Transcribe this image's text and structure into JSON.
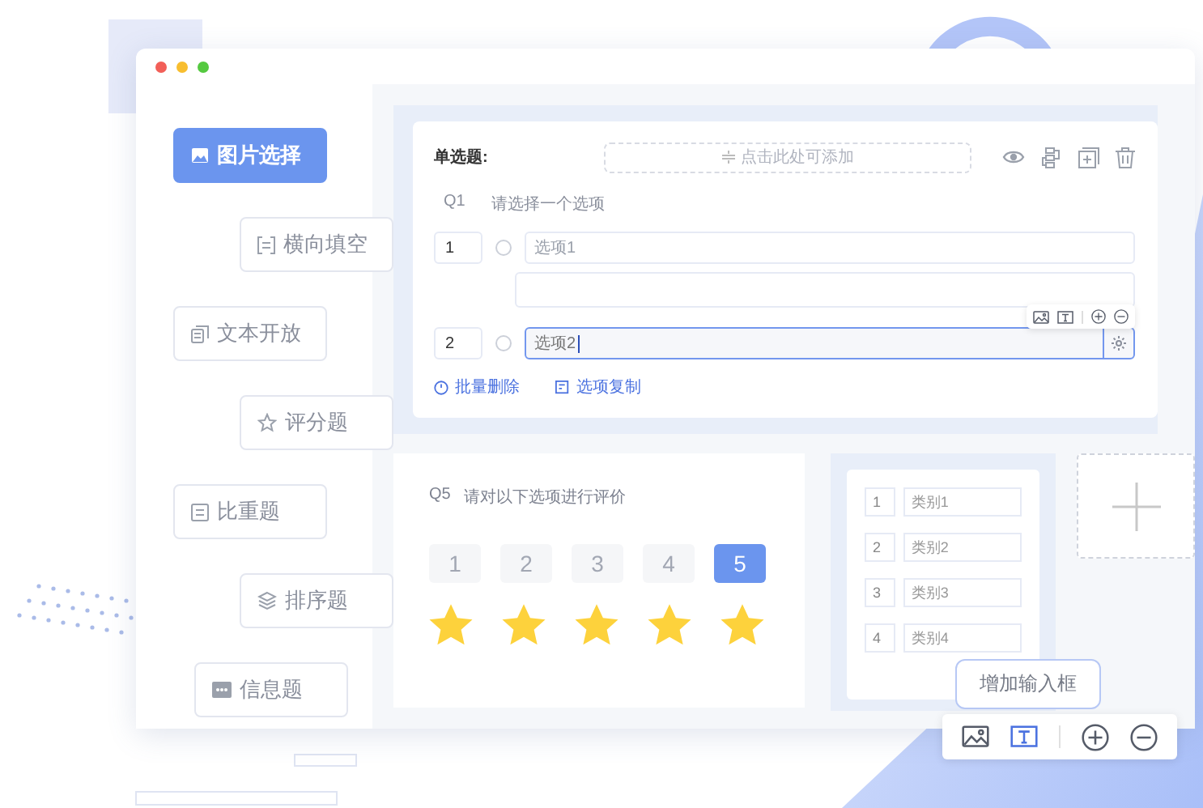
{
  "sidebar": {
    "items": [
      {
        "label": "图片选择",
        "kind": "image",
        "selected": true
      },
      {
        "label": "横向填空",
        "kind": "lines",
        "selected": false
      },
      {
        "label": "文本开放",
        "kind": "copy",
        "selected": false
      },
      {
        "label": "评分题",
        "kind": "star",
        "selected": false
      },
      {
        "label": "比重题",
        "kind": "list",
        "selected": false
      },
      {
        "label": "排序题",
        "kind": "layers",
        "selected": false
      },
      {
        "label": "信息题",
        "kind": "dots",
        "selected": false
      }
    ]
  },
  "question_card": {
    "type_label": "单选题:",
    "drop_zone": "点击此处可添加",
    "question_number": "Q1",
    "question_text": "请选择一个选项",
    "options": [
      {
        "number": "1",
        "placeholder": "选项1",
        "checked": false,
        "focused": false
      },
      {
        "number": "2",
        "value": "选项2",
        "checked": false,
        "focused": true
      }
    ],
    "actions": [
      "批量删除",
      "选项复制"
    ]
  },
  "rating": {
    "question_number": "Q5",
    "question_text": "请对以下选项进行评价",
    "scores": [
      {
        "label": "1",
        "selected": false
      },
      {
        "label": "2",
        "selected": false
      },
      {
        "label": "3",
        "selected": false
      },
      {
        "label": "4",
        "selected": false
      },
      {
        "label": "5",
        "selected": true
      }
    ],
    "stars": 5
  },
  "categories": [
    {
      "number": "1",
      "placeholder": "类别1"
    },
    {
      "number": "2",
      "placeholder": "类别2"
    },
    {
      "number": "3",
      "placeholder": "类别3"
    },
    {
      "number": "4",
      "placeholder": "类别4"
    }
  ],
  "tooltip": "增加输入框",
  "tools": [
    {
      "kind": "image",
      "selected": false
    },
    {
      "kind": "text",
      "selected": true
    },
    {
      "kind": "add",
      "selected": false
    },
    {
      "kind": "remove",
      "selected": false
    }
  ]
}
